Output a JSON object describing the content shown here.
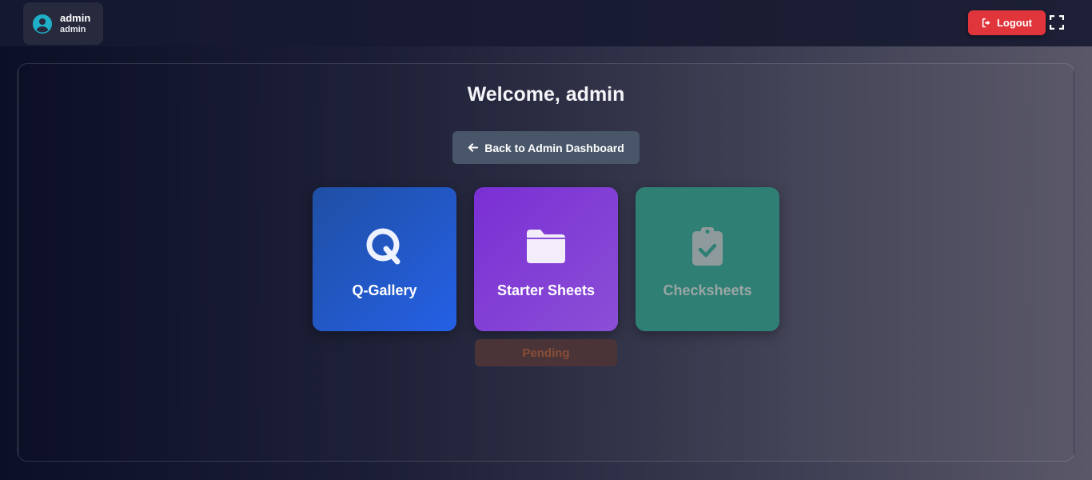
{
  "header": {
    "user": {
      "name": "admin",
      "role": "admin"
    },
    "logout_label": "Logout",
    "colors": {
      "logout": "#e0353b",
      "avatar": "#1fb0c8"
    }
  },
  "main": {
    "welcome": "Welcome, admin",
    "back_button_label": "Back to Admin Dashboard",
    "cards": [
      {
        "label": "Q-Gallery",
        "icon": "q-icon",
        "color": "#2560e6"
      },
      {
        "label": "Starter Sheets",
        "icon": "folder-icon",
        "color": "#7a2fd4",
        "status": "Pending"
      },
      {
        "label": "Checksheets",
        "icon": "clipboard-check-icon",
        "color": "#2f7f74"
      }
    ]
  }
}
